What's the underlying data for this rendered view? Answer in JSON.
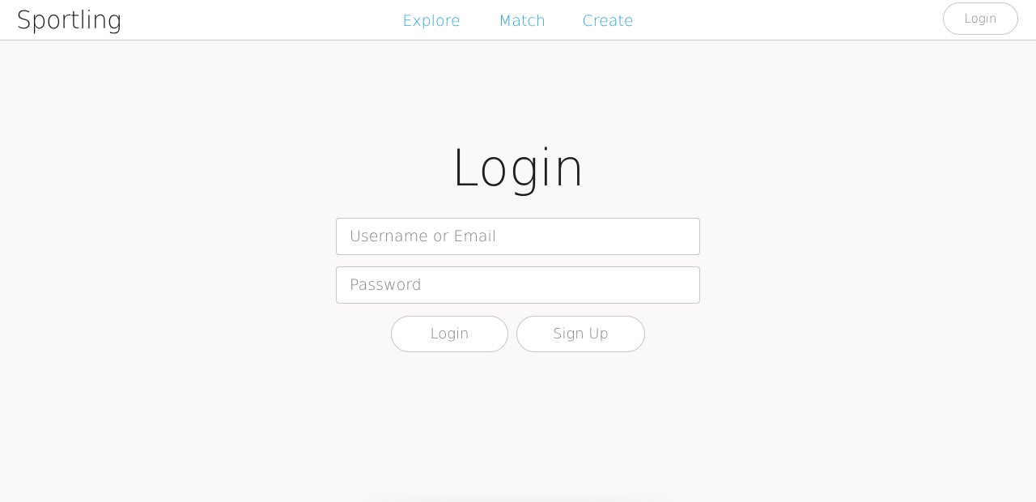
{
  "header": {
    "logo": "Sportling",
    "nav": {
      "explore": "Explore",
      "match": "Match",
      "create": "Create"
    },
    "login_label": "Login",
    "accent_color": "#29a8e0"
  },
  "main": {
    "title": "Login",
    "username_placeholder": "Username or Email",
    "password_placeholder": "Password",
    "login_button": "Login",
    "signup_button": "Sign Up"
  }
}
